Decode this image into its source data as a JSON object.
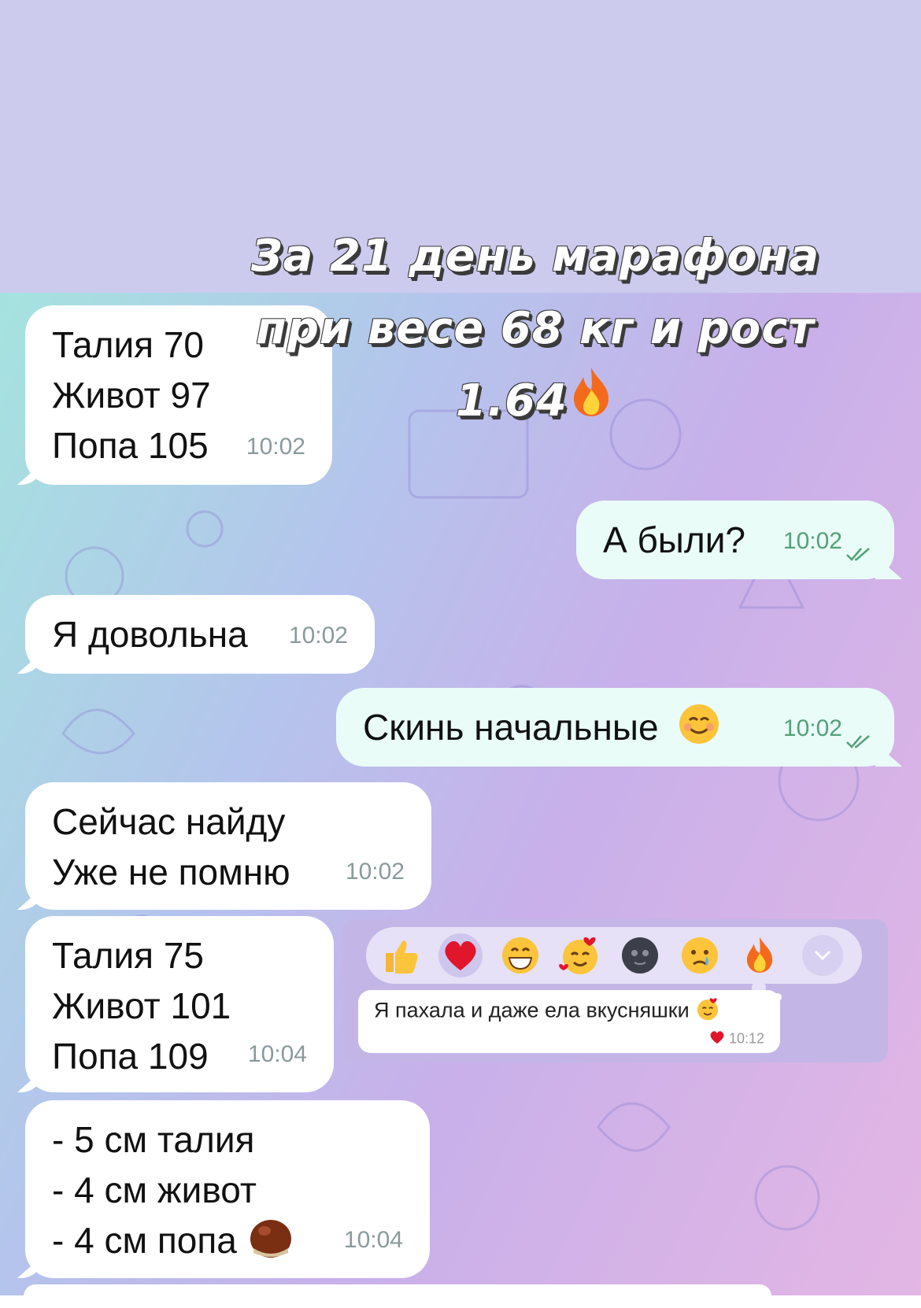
{
  "overlay": {
    "line1": "За 21 день марафона",
    "line2": "при весе 68 кг и рост",
    "line3": "1.64",
    "emoji": "fire-icon"
  },
  "messages": [
    {
      "dir": "in",
      "lines": [
        "Талия 70",
        "Живот 97",
        "Попа 105"
      ],
      "time": "10:02"
    },
    {
      "dir": "out",
      "text": "А были?",
      "time": "10:02",
      "status": "read"
    },
    {
      "dir": "in",
      "text": "Я довольна",
      "time": "10:02"
    },
    {
      "dir": "out",
      "text": "Скинь начальные",
      "emoji": "smiling-face-icon",
      "time": "10:02",
      "status": "read"
    },
    {
      "dir": "in",
      "lines": [
        "Сейчас найду",
        "Уже не помню"
      ],
      "time": "10:02"
    },
    {
      "dir": "in",
      "lines": [
        "Талия 75",
        "Живот 101",
        "Попа 109"
      ],
      "time": "10:04"
    },
    {
      "dir": "in",
      "lines": [
        "- 5 см талия",
        "- 4 см живот",
        "- 4 см попа"
      ],
      "emoji": "chestnut-icon",
      "time": "10:04"
    }
  ],
  "popup": {
    "reactions": [
      "thumbs-up-icon",
      "heart-icon",
      "grinning-icon",
      "smiling-hearts-icon",
      "new-moon-face-icon",
      "crying-face-icon",
      "fire-icon"
    ],
    "expand_icon": "chevron-down-icon",
    "message_text": "Я пахала и даже ела вкусняшки",
    "message_emoji": "smiling-hearts-icon",
    "message_reaction": "heart-icon",
    "message_time": "10:12"
  },
  "colors": {
    "top_band": "#cccbee",
    "incoming_bubble": "#ffffff",
    "outgoing_bubble": "#e9fcf7",
    "time_in": "#8a9a9c",
    "time_out": "#55a07a"
  }
}
